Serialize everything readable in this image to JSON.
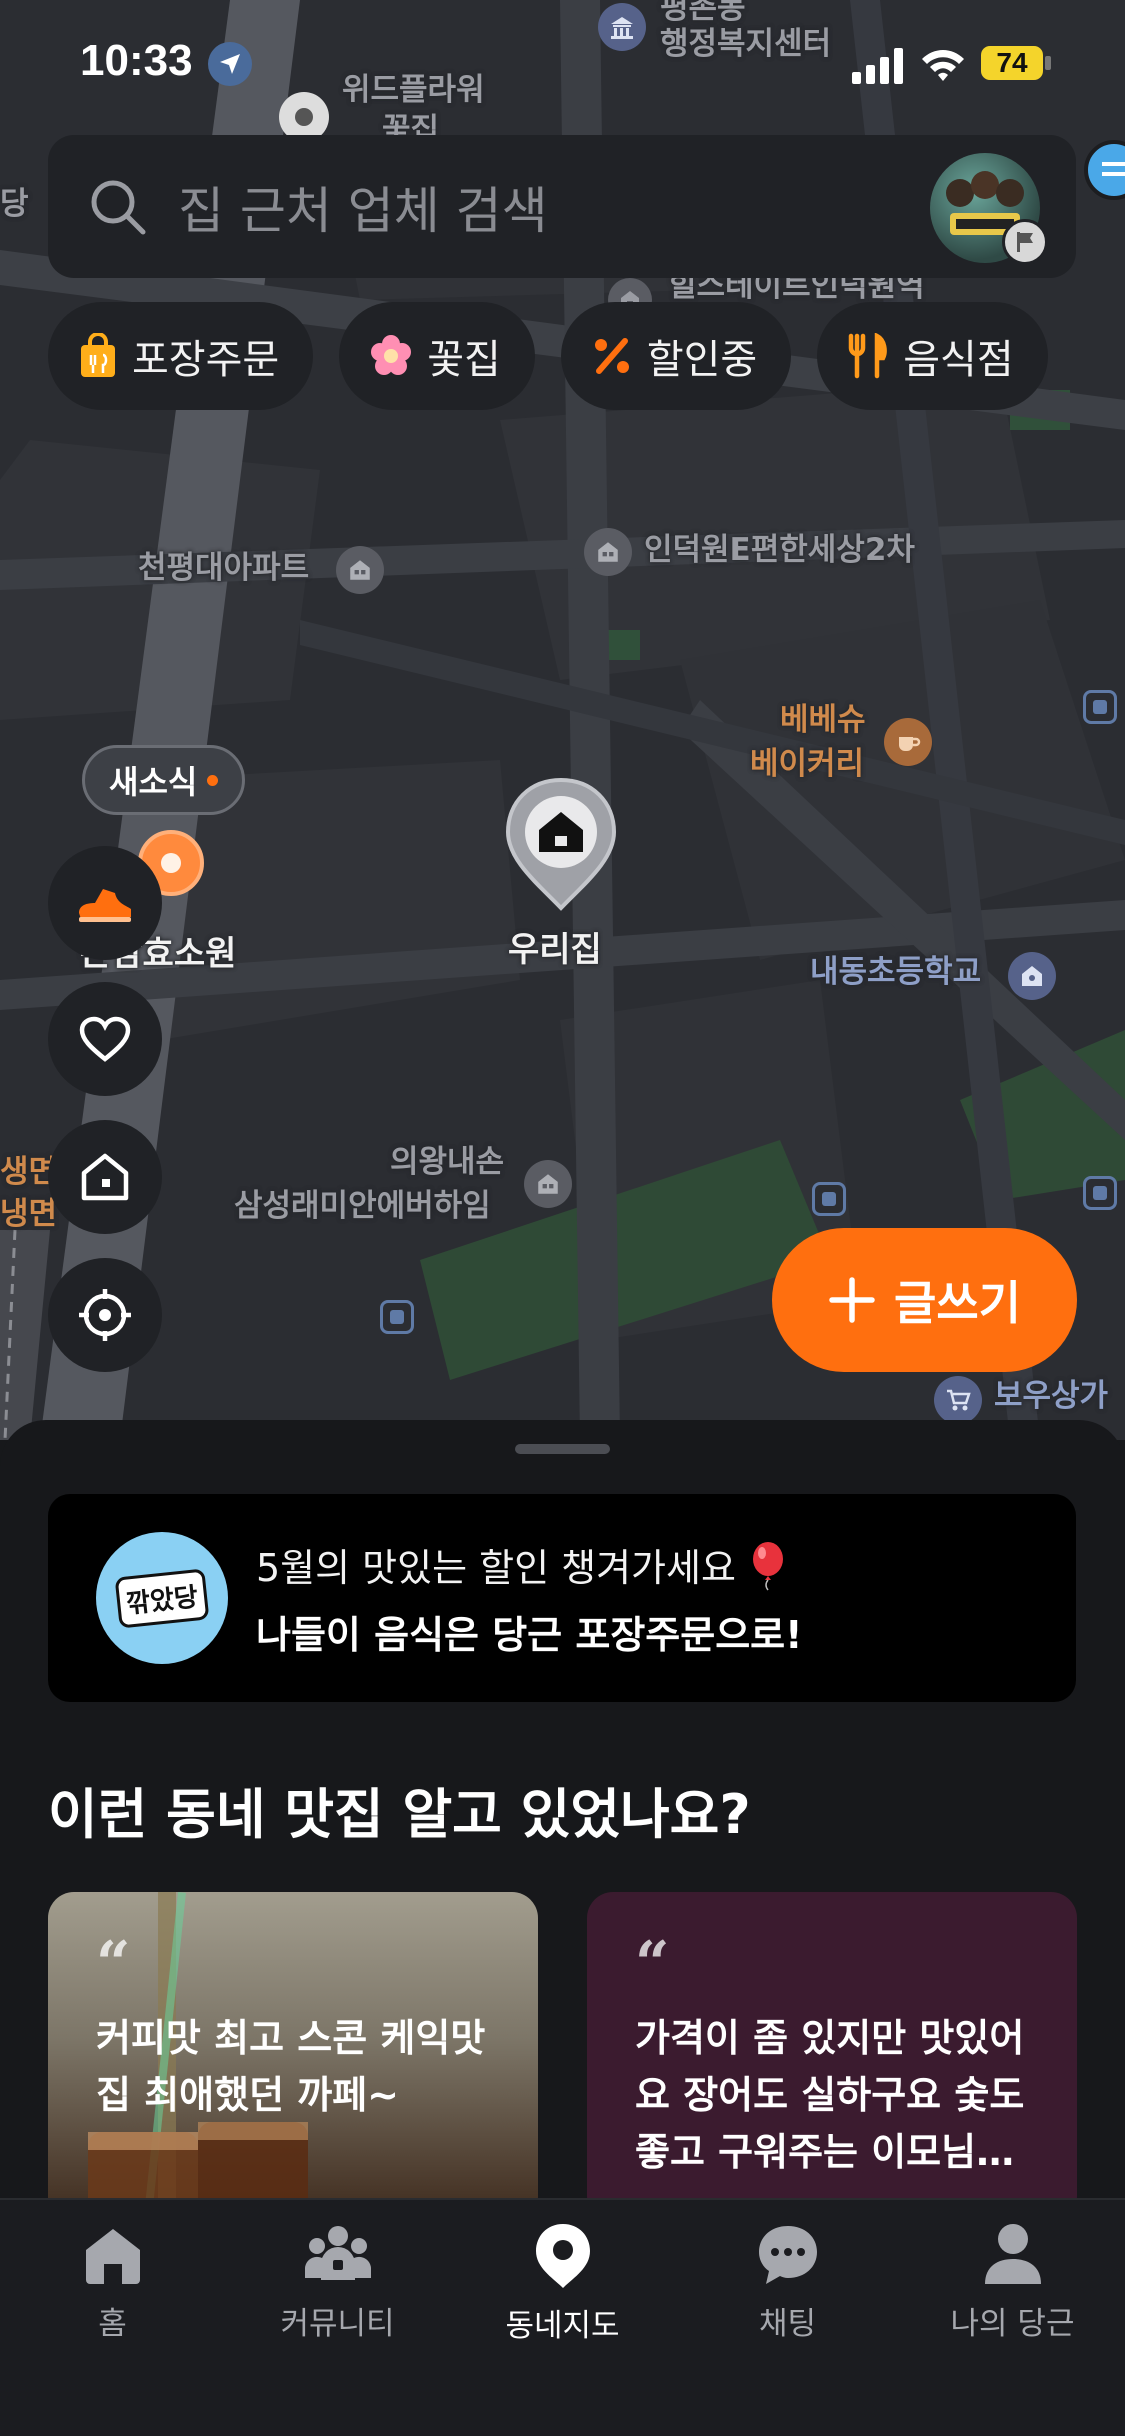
{
  "status_bar": {
    "time": "10:33",
    "battery": "74"
  },
  "search": {
    "placeholder": "집 근처 업체 검색"
  },
  "chips": [
    {
      "label": "포장주문",
      "icon": "takeout-bag-icon"
    },
    {
      "label": "꽃집",
      "icon": "flower-icon"
    },
    {
      "label": "할인중",
      "icon": "percent-icon"
    },
    {
      "label": "음식점",
      "icon": "fork-knife-icon"
    }
  ],
  "map": {
    "labels": {
      "top_center": "평촌동",
      "welfare_center": "행정복지센터",
      "wide_flower": "위드플라워",
      "wide_flower2": "꽃집",
      "left_edge": "당",
      "estate": "힐스테이트인덕원역",
      "cheonpyeong": "천평대아파트",
      "indeogwon": "인덕원E편한세상2차",
      "bebeshu1": "베베슈",
      "bebeshu2": "베이커리",
      "hyoso": "은감효소원",
      "home": "우리집",
      "naedong": "내동초등학교",
      "uiwang1": "의왕내손",
      "uiwang2": "삼성래미안에버하임",
      "left_edge2": "생면",
      "left_edge3": "냉면",
      "bowoo": "보우상가"
    },
    "news_tag": "새소식"
  },
  "write_button": {
    "label": "글쓰기"
  },
  "sheet": {
    "promo": {
      "logo_text": "깎았당",
      "line1": "5월의 맛있는 할인 챙겨가세요",
      "line2": "나들이 음식은 당근 포장주문으로!"
    },
    "section_title": "이런 동네 맛집 알고 있었나요?",
    "cards": [
      {
        "quote": "“",
        "text": "커피맛 최고 스콘 케익맛 집 최애했던 까페~"
      },
      {
        "quote": "“",
        "text": "가격이 좀 있지만 맛있어요 장어도 실하구요 숯도 좋고 구워주는 이모님…"
      }
    ]
  },
  "tabbar": [
    {
      "label": "홈",
      "icon": "home-icon",
      "active": false
    },
    {
      "label": "커뮤니티",
      "icon": "community-icon",
      "active": false
    },
    {
      "label": "동네지도",
      "icon": "map-pin-icon",
      "active": true
    },
    {
      "label": "채팅",
      "icon": "chat-icon",
      "active": false
    },
    {
      "label": "나의 당근",
      "icon": "profile-icon",
      "active": false
    }
  ],
  "colors": {
    "accent": "#ff6f0f",
    "map_bg": "#2b2d32",
    "sheet_bg": "#17181b"
  }
}
